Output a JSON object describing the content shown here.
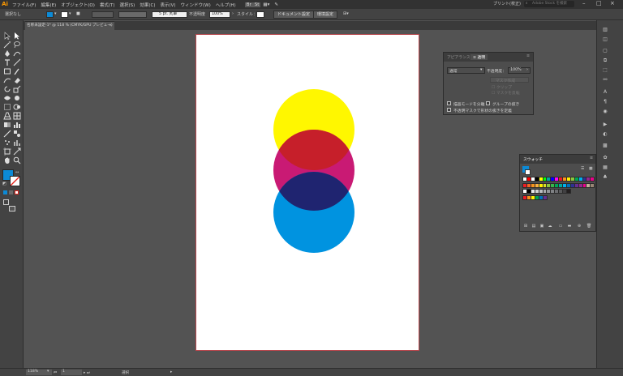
{
  "menubar": {
    "logo": "Ai",
    "items": [
      "ファイル(F)",
      "編集(E)",
      "オブジェクト(O)",
      "書式(T)",
      "選択(S)",
      "効果(C)",
      "表示(V)",
      "ウィンドウ(W)",
      "ヘルプ(H)"
    ],
    "workspace": "プリント(校正)",
    "search_placeholder": "Adobe Stock を検索",
    "win_min": "–",
    "win_max": "□",
    "win_close": "×"
  },
  "controlbar": {
    "selection_label": "選択なし",
    "stroke_size": "5 pt. 丸筆",
    "opacity_label": "不透明度",
    "opacity_value": "100%",
    "style_label": "スタイル：",
    "doc_setup_btn": "ドキュメント設定",
    "prefs_btn": "環境設定"
  },
  "document_tab": {
    "title": "名称未設定-1* @ 118 % (CMYK/GPU プレビュー)",
    "close": "×"
  },
  "transparency_panel": {
    "tab_appearance": "アピアランス",
    "tab_transparency": "透明",
    "blend_mode": "通常",
    "opacity_label": "不透明度：",
    "opacity_value": "100%",
    "disabled_make_mask": "マスク作成",
    "disabled_clip": "クリップ",
    "disabled_invert": "マスクを反転",
    "isolate_blending": "描画モードを分離",
    "knockout_group": "グループの抜き",
    "opacity_mask_define": "不透明マスクで形状の抜きを定義"
  },
  "swatches_panel": {
    "title": "スウォッチ",
    "rows": [
      [
        "#ffffff",
        "#ff0000",
        "#ffffff",
        "#000000",
        "#ffff00",
        "#00ff00",
        "#00a99d",
        "#0000ff",
        "#ff00ff",
        "#ed1c24",
        "#f7941d",
        "#fff200",
        "#8cc63f",
        "#00a651",
        "#00aeef",
        "#2e3192",
        "#92278f",
        "#ec008c"
      ],
      [
        "#ed1c24",
        "#f26522",
        "#f7941d",
        "#fbb040",
        "#fff200",
        "#d7df23",
        "#8dc63f",
        "#39b54a",
        "#00a651",
        "#00a99d",
        "#00aeef",
        "#0072bc",
        "#2e3192",
        "#662d91",
        "#92278f",
        "#ec008c",
        "#c7b299",
        "#998675"
      ],
      [
        "#ffffff",
        "#000000",
        "#e6e7e8",
        "#d1d3d4",
        "#bcbec0",
        "#a7a9ac",
        "#939598",
        "#808285",
        "#6d6e71",
        "#58595b",
        "#414042",
        "#231f20"
      ],
      [
        "#ed1c24",
        "#f7941d",
        "#fff200",
        "#00a651",
        "#0072bc",
        "#662d91"
      ]
    ]
  },
  "statusbar": {
    "zoom": "118%",
    "page": "1",
    "tool": "選択"
  },
  "colors": {
    "circle_yellow": "#fff700",
    "circle_magenta": "#c91a74",
    "circle_cyan": "#0093e0",
    "overlap_red": "#c61f2a",
    "overlap_navy": "#1f2470",
    "fill_swatch": "#0c8ad6",
    "artboard_border": "#b7474d"
  }
}
